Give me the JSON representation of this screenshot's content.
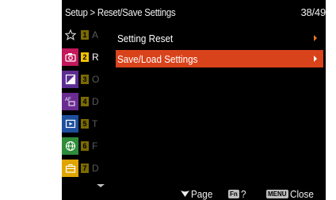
{
  "header": {
    "title": "Setup > Reset/Save Settings",
    "page_counter": "38/49"
  },
  "sidebar": {
    "tabs": [
      {
        "icon": "star-icon",
        "color": "#000000"
      },
      {
        "icon": "camera-icon",
        "color": "#c2185b"
      },
      {
        "icon": "exposure-icon",
        "color": "#5c2d91"
      },
      {
        "icon": "focus-icon",
        "color": "#6a2c91"
      },
      {
        "icon": "playback-icon",
        "color": "#1d4f9c"
      },
      {
        "icon": "network-icon",
        "color": "#2f8c3a"
      },
      {
        "icon": "toolbox-icon",
        "color": "#e0a400"
      }
    ]
  },
  "subcategories": [
    {
      "num": "1",
      "abbr": "A",
      "num_color": "#7a6a00",
      "active": false
    },
    {
      "num": "2",
      "abbr": "R",
      "num_color": "#f2c200",
      "active": true
    },
    {
      "num": "3",
      "abbr": "O",
      "num_color": "#7a6a00",
      "active": false
    },
    {
      "num": "4",
      "abbr": "D",
      "num_color": "#7a6a00",
      "active": false
    },
    {
      "num": "5",
      "abbr": "T",
      "num_color": "#7a6a00",
      "active": false
    },
    {
      "num": "6",
      "abbr": "F",
      "num_color": "#7a6a00",
      "active": false
    },
    {
      "num": "7",
      "abbr": "D",
      "num_color": "#7a6a00",
      "active": false
    }
  ],
  "menu": {
    "items": [
      {
        "label": "Setting Reset",
        "selected": false
      },
      {
        "label": "Save/Load Settings",
        "selected": true
      }
    ]
  },
  "footer": {
    "page_label": "Page",
    "help_label": "?",
    "help_key": "Fn",
    "close_label": "Close",
    "close_key": "MENU"
  },
  "colors": {
    "selection": "#d9431b",
    "arrow": "#e8742a"
  }
}
